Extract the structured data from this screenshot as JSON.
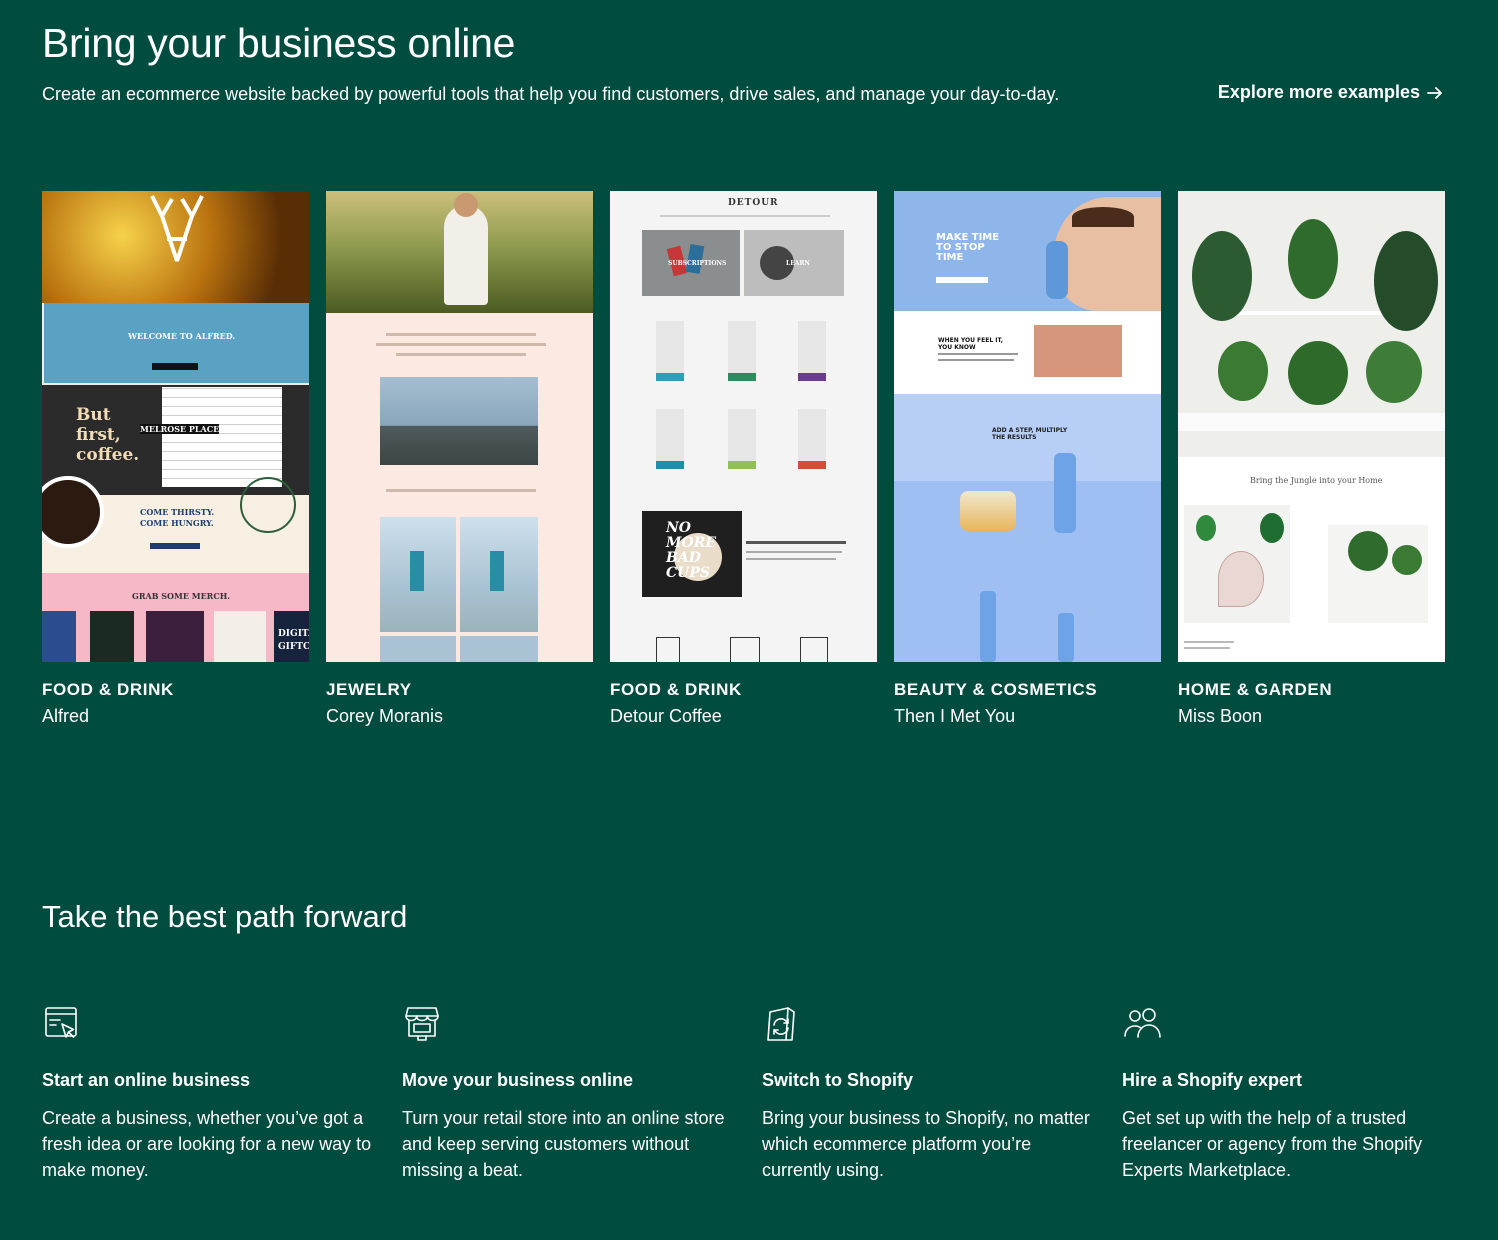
{
  "hero": {
    "title": "Bring your business online",
    "subtitle": "Create an ecommerce website backed by powerful tools that help you find customers, drive sales, and manage your day-to-day.",
    "explore_label": "Explore more examples",
    "explore_icon": "arrow-right-icon"
  },
  "examples": [
    {
      "category": "FOOD & DRINK",
      "name": "Alfred",
      "texts": {
        "welcome": "WELCOME TO ALFRED.",
        "but": "But",
        "first": "first,",
        "coffee": "coffee.",
        "melrose": "MELROSE PLACE",
        "thirsty": "COME THIRSTY.",
        "hungry": "COME HUNGRY.",
        "merch": "GRAB SOME MERCH.",
        "digital": "DIGITA",
        "giftc": "GIFTC"
      }
    },
    {
      "category": "JEWELRY",
      "name": "Corey Moranis"
    },
    {
      "category": "FOOD & DRINK",
      "name": "Detour Coffee",
      "texts": {
        "logo": "DETOUR",
        "subscriptions": "SUBSCRIPTIONS",
        "learn": "LEARN",
        "no": "NO",
        "more": "MORE",
        "bad": "BAD",
        "cups": "CUPS"
      }
    },
    {
      "category": "BEAUTY & COSMETICS",
      "name": "Then I Met You",
      "texts": {
        "make": "MAKE TIME",
        "tostop": "TO STOP",
        "time": "TIME",
        "feel": "WHEN YOU FEEL IT,",
        "know": "YOU KNOW",
        "step": "ADD A STEP, MULTIPLY",
        "results": "THE RESULTS"
      }
    },
    {
      "category": "HOME & GARDEN",
      "name": "Miss Boon",
      "texts": {
        "jungle": "Bring the Jungle into your Home"
      }
    }
  ],
  "paths_section": {
    "title": "Take the best path forward",
    "items": [
      {
        "icon": "online-store-icon",
        "title": "Start an online business",
        "body": "Create a business, whether you’ve got a fresh idea or are looking for a new way to make money."
      },
      {
        "icon": "storefront-icon",
        "title": "Move your business online",
        "body": "Turn your retail store into an online store and keep serving customers without missing a beat."
      },
      {
        "icon": "switch-icon",
        "title": "Switch to Shopify",
        "body": "Bring your business to Shopify, no matter which ecommerce platform you’re currently using."
      },
      {
        "icon": "people-icon",
        "title": "Hire a Shopify expert",
        "body": "Get set up with the help of a trusted freelancer or agency from the Shopify Experts Marketplace."
      }
    ]
  },
  "colors": {
    "background": "#004c3f",
    "text": "#ffffff"
  }
}
